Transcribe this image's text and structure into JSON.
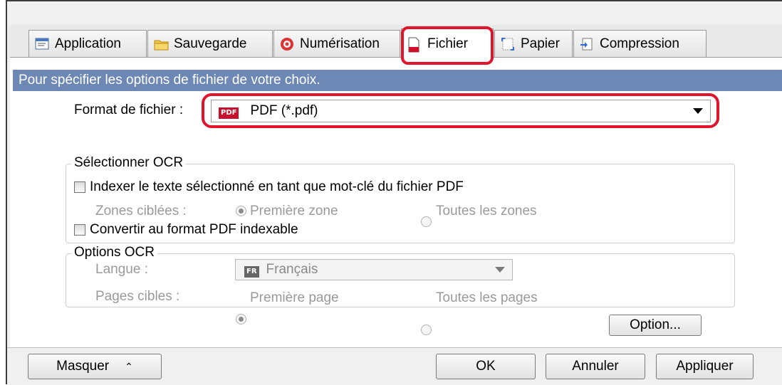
{
  "tabs": [
    {
      "label": "Application",
      "icon": "application-icon"
    },
    {
      "label": "Sauvegarde",
      "icon": "folder-icon"
    },
    {
      "label": "Numérisation",
      "icon": "scan-icon"
    },
    {
      "label": "Fichier",
      "icon": "file-icon",
      "active": true
    },
    {
      "label": "Papier",
      "icon": "paper-icon"
    },
    {
      "label": "Compression",
      "icon": "compression-icon"
    }
  ],
  "header": {
    "text": "Pour spécifier les options de fichier de votre choix."
  },
  "file_format": {
    "label": "Format de fichier :",
    "badge": "PDF",
    "value": "PDF (*.pdf)"
  },
  "ocr_select": {
    "legend": "Sélectionner OCR",
    "index_checkbox": "Indexer le texte sélectionné en tant que mot-clé du fichier PDF",
    "zones_label": "Zones ciblées :",
    "zone_first": "Première zone",
    "zone_all": "Toutes les zones",
    "convert_checkbox": "Convertir au format PDF indexable"
  },
  "ocr_options": {
    "legend": "Options OCR",
    "language_label": "Langue :",
    "language_badge": "FR",
    "language_value": "Français",
    "pages_label": "Pages cibles :",
    "page_first": "Première page",
    "page_all": "Toutes les pages",
    "option_button": "Option..."
  },
  "footer": {
    "hide_button": "Masquer",
    "ok_button": "OK",
    "cancel_button": "Annuler",
    "apply_button": "Appliquer"
  },
  "colors": {
    "header_bg": "#6d88b4",
    "highlight": "#e0142d",
    "pdf_badge": "#c8102e",
    "fr_badge": "#666666"
  }
}
